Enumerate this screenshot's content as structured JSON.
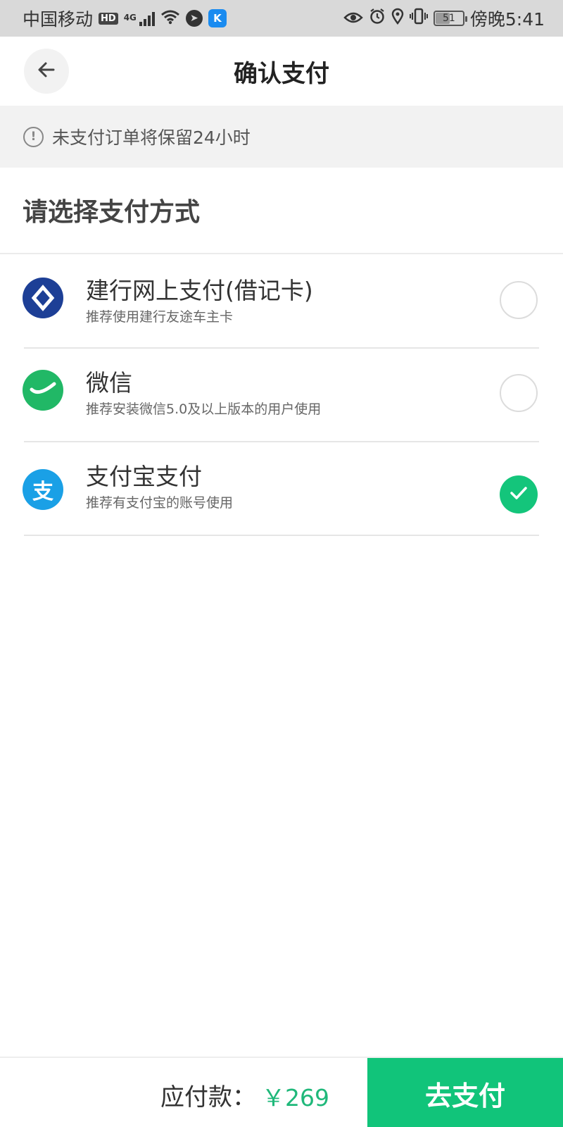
{
  "status_bar": {
    "carrier": "中国移动",
    "hd_badge": "HD",
    "network": "4G",
    "k_badge": "K",
    "battery": "51",
    "time": "傍晚5:41"
  },
  "header": {
    "title": "确认支付"
  },
  "notice": {
    "text": "未支付订单将保留24小时"
  },
  "section": {
    "title": "请选择支付方式"
  },
  "payment_methods": [
    {
      "name": "建行网上支付(借记卡)",
      "desc": "推荐使用建行友途车主卡",
      "icon": "ccb-logo-icon",
      "selected": false
    },
    {
      "name": "微信",
      "desc": "推荐安装微信5.0及以上版本的用户使用",
      "icon": "wechat-logo-icon",
      "selected": false
    },
    {
      "name": "支付宝支付",
      "desc": "推荐有支付宝的账号使用",
      "icon": "alipay-logo-icon",
      "selected": true
    }
  ],
  "bottom": {
    "due_label": "应付款：",
    "amount": "￥269",
    "pay_button": "去支付"
  },
  "colors": {
    "accent": "#11c47a",
    "amount": "#1fb87a",
    "ccb_blue": "#1d3f96",
    "wechat_green": "#21b866",
    "alipay_blue": "#1aa0e6"
  }
}
